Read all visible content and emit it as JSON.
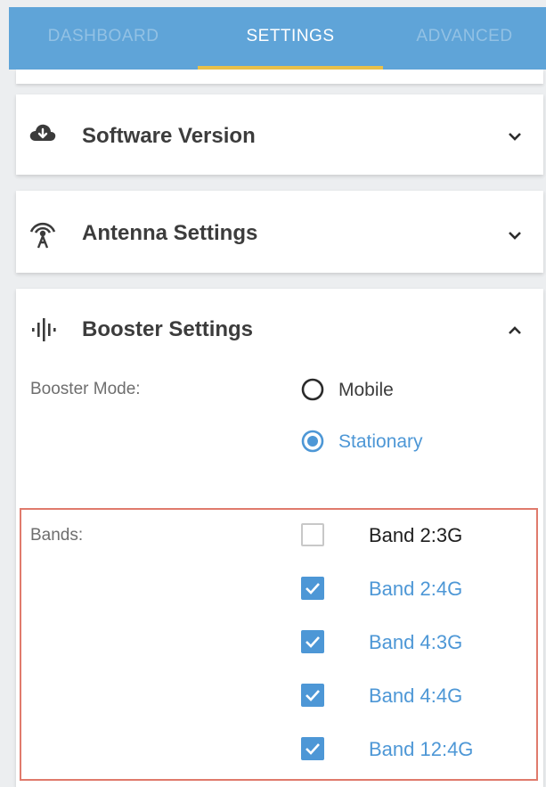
{
  "tabs": [
    {
      "label": "DASHBOARD"
    },
    {
      "label": "SETTINGS"
    },
    {
      "label": "ADVANCED"
    }
  ],
  "panels": {
    "software": {
      "title": "Software Version",
      "icon": "cloud-download-icon"
    },
    "antenna": {
      "title": "Antenna Settings",
      "icon": "antenna-icon"
    },
    "booster": {
      "title": "Booster Settings",
      "icon": "signal-bars-icon"
    }
  },
  "booster_mode": {
    "label": "Booster Mode:",
    "options": [
      {
        "label": "Mobile",
        "selected": false
      },
      {
        "label": "Stationary",
        "selected": true
      }
    ]
  },
  "bands": {
    "label": "Bands:",
    "items": [
      {
        "label": "Band 2:3G",
        "checked": false
      },
      {
        "label": "Band 2:4G",
        "checked": true
      },
      {
        "label": "Band 4:3G",
        "checked": true
      },
      {
        "label": "Band 4:4G",
        "checked": true
      },
      {
        "label": "Band 12:4G",
        "checked": true
      }
    ]
  },
  "colors": {
    "tabbar": "#5fa4d8",
    "indicator": "#e8c04a",
    "accent": "#4d97d6",
    "highlight_border": "#e07a6c"
  }
}
